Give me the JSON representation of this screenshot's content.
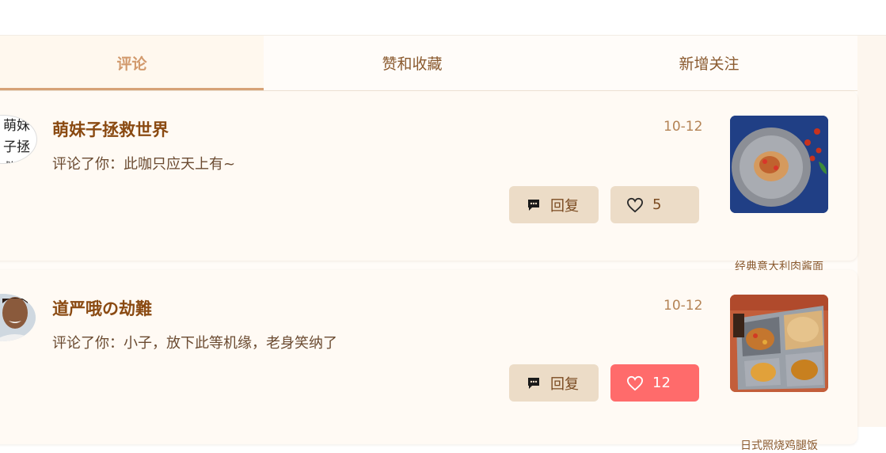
{
  "tabs": [
    {
      "label": "评论",
      "active": true
    },
    {
      "label": "赞和收藏",
      "active": false
    },
    {
      "label": "新增关注",
      "active": false
    }
  ],
  "notifications": [
    {
      "user": "萌妹子拯救世界",
      "avatar_alt": "萌妹子拯救世界",
      "date": "10-12",
      "text": "评论了你：此咖只应天上有~",
      "reply_label": "回复",
      "like_count": "5",
      "liked": false,
      "dish_caption": "经典意大利肉酱面"
    },
    {
      "user": "道严哦の劫難",
      "date": "10-12",
      "text": "评论了你：小子，放下此等机缘，老身笑纳了",
      "reply_label": "回复",
      "like_count": "12",
      "liked": true,
      "dish_caption": "日式照烧鸡腿饭"
    }
  ],
  "colors": {
    "accent": "#d7a377",
    "name": "#8a4a12",
    "button": "#ecdcc7",
    "liked": "#ff6b6b"
  },
  "icons": {
    "reply": "chat-bubble-icon",
    "like": "heart-icon"
  }
}
